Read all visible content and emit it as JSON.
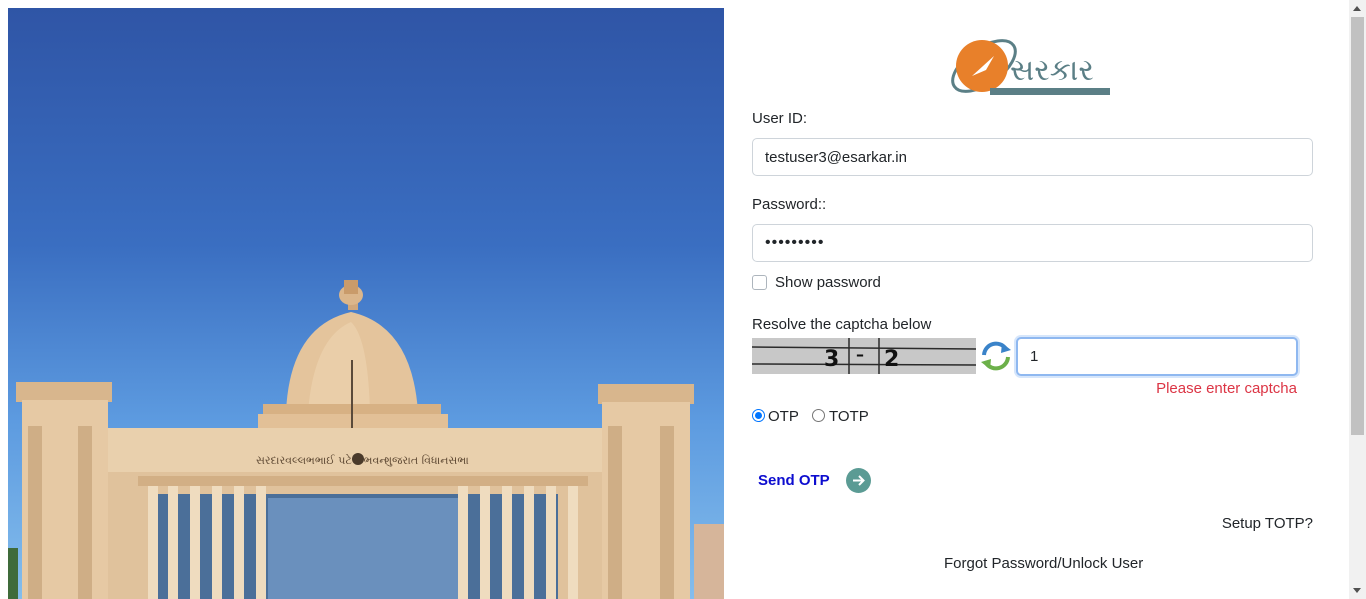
{
  "hero": {
    "building_sign_left": "સરદારવલ્લભભાઈ પટેલ ભવન",
    "building_sign_right": "ગુજરાત વિધાનસભા"
  },
  "logo": {
    "text": "સરકાર"
  },
  "form": {
    "userid_label": "User ID:",
    "userid_value": "testuser3@esarkar.in",
    "password_label": "Password::",
    "password_value": "•••••••••",
    "show_password_label": "Show password",
    "captcha_label": "Resolve the captcha below",
    "captcha_text_1": "3",
    "captcha_text_2": "–",
    "captcha_text_3": "2",
    "captcha_value": "1",
    "captcha_error": "Please enter captcha",
    "otp_label": "OTP",
    "totp_label": "TOTP",
    "otp_selected": true,
    "send_otp_label": "Send OTP",
    "setup_totp_label": "Setup TOTP?",
    "forgot_password_label": "Forgot Password/Unlock User"
  },
  "colors": {
    "error": "#dc3545",
    "link_blue": "#0d0dcf",
    "send_icon_bg": "#5b9b94",
    "logo_orange": "#e8802a",
    "logo_slate": "#5b7f86"
  }
}
